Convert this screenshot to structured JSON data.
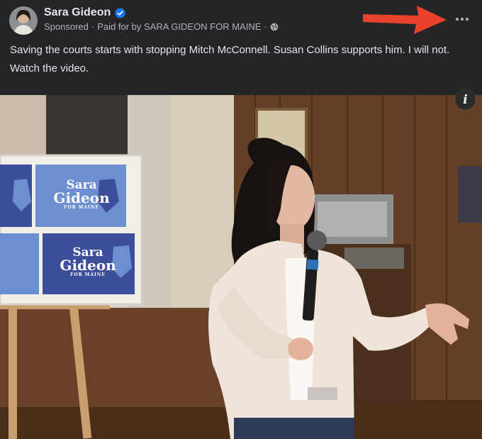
{
  "post": {
    "author": "Sara Gideon",
    "sponsored_label": "Sponsored",
    "separator": "·",
    "paid_for": "Paid for by SARA GIDEON FOR MAINE",
    "message_line1": "Saving the courts starts with stopping Mitch McConnell. Susan Collins supports him. I will not.",
    "message_line2": "Watch the video."
  },
  "media": {
    "info_label": "i",
    "signs": [
      {
        "first": "Sara",
        "last": "Gideon",
        "sub": "FOR MAINE"
      },
      {
        "first": "Sara",
        "last": "Gideon",
        "sub": "FOR MAINE"
      }
    ]
  },
  "icons": {
    "verified": "verified-badge-icon",
    "globe": "globe-icon",
    "more": "more-options-icon",
    "info": "info-icon",
    "arrow": "red-arrow-annotation"
  },
  "colors": {
    "background": "#242526",
    "text": "#e4e6eb",
    "secondary_text": "#b0b3b8",
    "verified_blue": "#1877f2",
    "annotation_red": "#e8412c"
  }
}
